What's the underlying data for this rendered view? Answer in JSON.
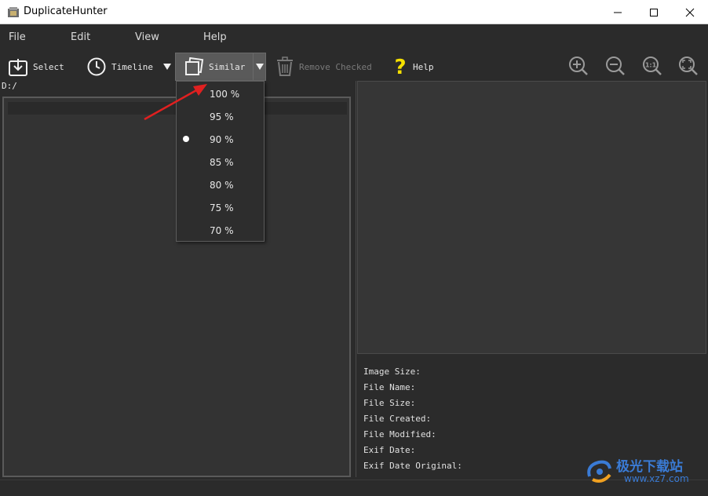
{
  "window": {
    "title": "DuplicateHunter"
  },
  "menu": {
    "items": [
      "File",
      "Edit",
      "View",
      "Help"
    ]
  },
  "toolbar": {
    "select_label": "Select",
    "timeline_label": "Timeline",
    "similar_label": "Similar",
    "remove_checked_label": "Remove Checked",
    "help_label": "Help",
    "zoom_buttons": [
      "zoom-in-icon",
      "zoom-out-icon",
      "zoom-actual-size-icon",
      "zoom-fit-icon"
    ]
  },
  "path": "D:/",
  "similarity_dropdown": {
    "options": [
      "100 %",
      "95 %",
      "90 %",
      "85 %",
      "80 %",
      "75 %",
      "70 %"
    ],
    "selected": "90 %"
  },
  "info": {
    "image_size": "Image Size:",
    "file_name": "File Name:",
    "file_size": "File Size:",
    "file_created": "File Created:",
    "file_modified": "File Modified:",
    "exif_date": "Exif Date:",
    "exif_date_original": "Exif Date Original:"
  },
  "watermark": {
    "text": "极光下载站",
    "url": "www.xz7.com"
  },
  "colors": {
    "background": "#2b2b2b",
    "panel": "#333333",
    "accent_arrow": "#e02020",
    "help_icon": "#f5e000",
    "watermark": "#3a7bd5"
  }
}
